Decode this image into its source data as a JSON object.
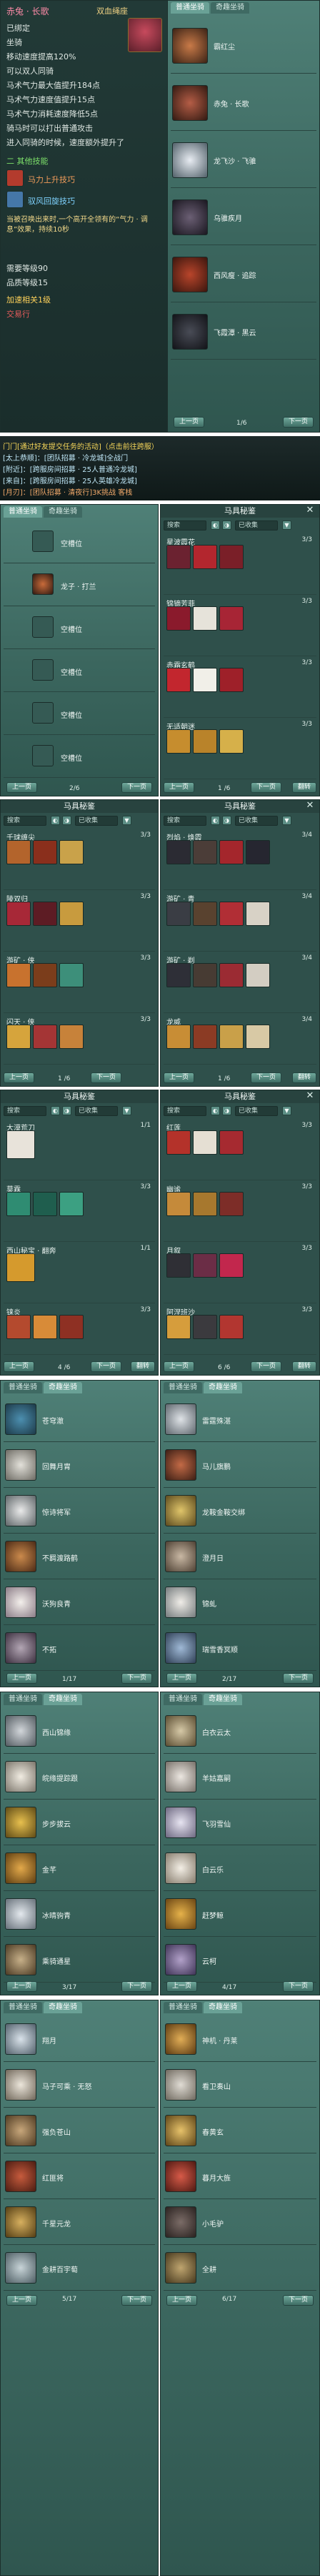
{
  "tooltip": {
    "title": "赤兔 · 长歌",
    "quality": "双血绳座",
    "lines": [
      "已绑定",
      "坐骑",
      "移动速度提高120%",
      "可以双人同骑",
      "马术气力最大值提升184点",
      "马术气力速度值提升15点",
      "马术气力消耗速度降低5点",
      "骑马时可以打出普通攻击",
      "进入同骑的时候，速度额外提升了"
    ],
    "slot_label": "二 其他技能",
    "slot1": "马力上升技巧",
    "slot2": "驭风回旋技巧",
    "desc": "当被召唤出来时,一个高开全领有的“气力 · 调息”效果，持续10秒",
    "req_label": "需要等级90",
    "quality_label": "品质等级15",
    "extra": "加速相关1级",
    "store": "交易行"
  },
  "chat": {
    "lines": [
      "门门[通过好友提交任务的活动]（点击前往跨服）",
      "[太上恭顺]：[团队招募 · 冷龙城]全战门",
      "[附近]：[跨服房间招募 · 25人普通冷龙城]",
      "[来自]：[跨服房间招募 · 25人英雄冷龙城]",
      "[月刃]：[团队招募 · 清夜行]3K挑战 客栈"
    ]
  },
  "tabs": {
    "normal": "普通坐骑",
    "rare": "奇趣坐骑"
  },
  "mount_secret": "马具秘鉴",
  "search": {
    "placeholder": "搜索",
    "filter": "已收集"
  },
  "buttons": {
    "prev": "上一页",
    "next": "下一页",
    "flip": "翻转"
  },
  "panel_a": {
    "page": "1/6",
    "items": [
      "霸红尘",
      "赤兔 · 长歌",
      "龙飞沙 · 飞骓",
      "乌骓疾月",
      "西风瘦 · 追踪",
      "飞霞潭 · 黑云"
    ]
  },
  "panel_b": {
    "page": "2/6",
    "empty": "空槽位",
    "items": [
      "空槽位",
      "龙子 · 打兰",
      "空槽位",
      "空槽位",
      "空槽位",
      "空槽位"
    ]
  },
  "panel_c": {
    "page": "1 /6",
    "rows": [
      {
        "name": "星波霞花",
        "count": "3/3"
      },
      {
        "name": "锦镝芳菲",
        "count": "3/3"
      },
      {
        "name": "赤霜玄鹤",
        "count": "3/3"
      },
      {
        "name": "无适朝迷",
        "count": "3/3"
      }
    ]
  },
  "panel_d": {
    "page": "1 /6",
    "rows": [
      {
        "name": "千球缠尖",
        "count": "3/3"
      },
      {
        "name": "陵双归",
        "count": "3/3"
      },
      {
        "name": "游矿 · 侠",
        "count": "3/3"
      },
      {
        "name": "闪天 · 侠",
        "count": "3/3"
      }
    ]
  },
  "panel_e": {
    "page": "1 /6",
    "rows": [
      {
        "name": "烈焰 · 焕霞",
        "count": "3/4"
      },
      {
        "name": "游矿 · 青",
        "count": "3/4"
      },
      {
        "name": "游矿 · 剃",
        "count": "3/4"
      },
      {
        "name": "龙威",
        "count": "3/4"
      }
    ]
  },
  "panel_f": {
    "page": "4 /6",
    "rows": [
      {
        "name": "大漠荒刀",
        "count": "1/1"
      },
      {
        "name": "莫霖",
        "count": "3/3"
      },
      {
        "name": "西山秘宝 · 翻奔",
        "count": "1/1"
      },
      {
        "name": "铼炎",
        "count": "3/3"
      }
    ]
  },
  "panel_g": {
    "page": "6 /6",
    "rows": [
      {
        "name": "红莲",
        "count": "3/3"
      },
      {
        "name": "幽谧",
        "count": "3/3"
      },
      {
        "name": "月叙",
        "count": "3/3"
      },
      {
        "name": "阿涅班沙",
        "count": "3/3"
      }
    ]
  },
  "panel_h": {
    "page": "1/17",
    "items": [
      "苍穹澈",
      "回舞月胄",
      "惊诗将军",
      "不羁渡路鹤",
      "沃狗良青",
      "不拓"
    ]
  },
  "panel_i": {
    "page": "2/17",
    "items": [
      "雷霆殊湛",
      "马儿旗鹏",
      "龙鞍金鞍交绑",
      "澄月日",
      "锦虬",
      "瑞雪香冥顺"
    ]
  },
  "panel_j": {
    "page": "3/17",
    "items": [
      "西山锦缘",
      "皖缘提踪跟",
      "步步拔云",
      "金芊",
      "冰晴驹青",
      "乘骑通星"
    ]
  },
  "panel_k": {
    "page": "4/17",
    "items": [
      "白衣云太",
      "羊姑嘉嗣",
      "飞羽雪仙",
      "白云乐",
      "赶梦鲸",
      "云柯"
    ]
  },
  "panel_l": {
    "page": "5/17",
    "items": [
      "翔月",
      "马子可乘 · 无怒",
      "强负苍山",
      "红匪将",
      "千星元龙",
      "金耕百宇萄"
    ]
  },
  "panel_m": {
    "page": "6/17",
    "items": [
      "神机 · 丹莱",
      "看卫奏山",
      "春黄玄",
      "暮月大旌",
      "小毛驴",
      "全耕"
    ]
  }
}
